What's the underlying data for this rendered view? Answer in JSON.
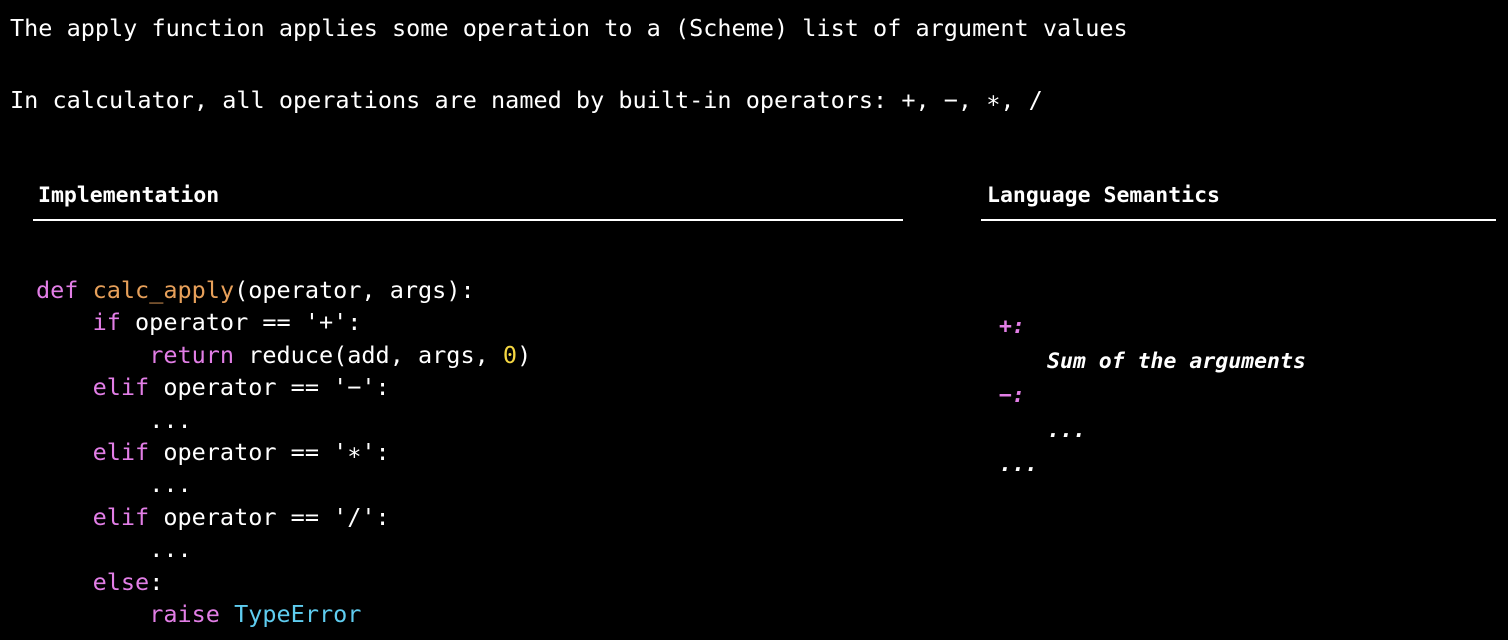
{
  "intro": {
    "line1": "The apply function applies some operation to a (Scheme) list of argument values",
    "line2": "In calculator, all operations are named by built-in operators: +, −, ∗, /"
  },
  "implementation": {
    "heading": "Implementation",
    "code": {
      "l1_kw": "def",
      "l1_fn": "calc_apply",
      "l1_rest": "(operator, args):",
      "l2_kw": "if",
      "l2_rest": " operator == '+':",
      "l3_kw": "return",
      "l3_rest": " reduce(add, args, ",
      "l3_num": "0",
      "l3_end": ")",
      "l4_kw": "elif",
      "l4_rest": " operator == '−':",
      "l5": "...",
      "l6_kw": "elif",
      "l6_rest": " operator == '∗':",
      "l7": "...",
      "l8_kw": "elif",
      "l8_rest": " operator == '/':",
      "l9": "...",
      "l10_kw": "else",
      "l10_rest": ":",
      "l11_kw": "raise",
      "l11_cls": "TypeError"
    }
  },
  "semantics": {
    "heading": "Language Semantics",
    "items": [
      {
        "op": "+:",
        "desc": "Sum of the arguments"
      },
      {
        "op": "−:",
        "desc": "..."
      }
    ],
    "more": "..."
  },
  "colors": {
    "background": "#000000",
    "keyword": "#e27ee6",
    "function": "#e7a05a",
    "number": "#f5d742",
    "class": "#5fcdf0",
    "text": "#ffffff"
  }
}
